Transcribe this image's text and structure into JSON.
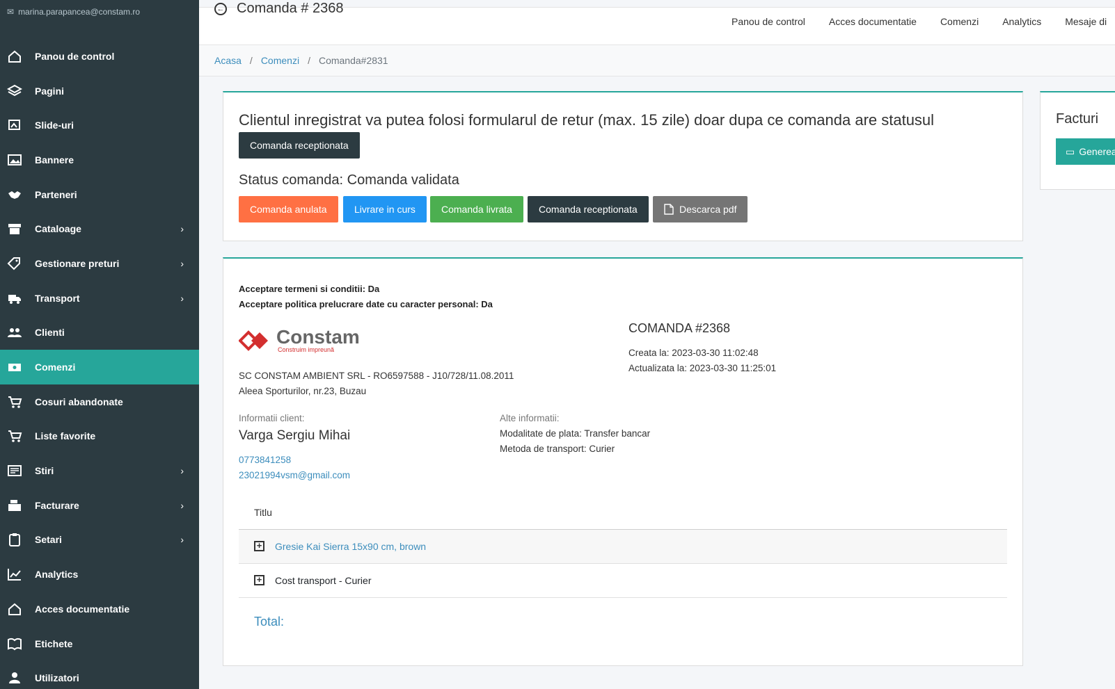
{
  "user": {
    "email": "marina.parapancea@constam.ro"
  },
  "sidebar": {
    "items": [
      {
        "label": "Panou de control",
        "icon": "home-icon",
        "has_children": false,
        "active": false
      },
      {
        "label": "Pagini",
        "icon": "layers-icon",
        "has_children": false,
        "active": false
      },
      {
        "label": "Slide-uri",
        "icon": "slides-icon",
        "has_children": false,
        "active": false
      },
      {
        "label": "Bannere",
        "icon": "image-icon",
        "has_children": false,
        "active": false
      },
      {
        "label": "Parteneri",
        "icon": "handshake-icon",
        "has_children": false,
        "active": false
      },
      {
        "label": "Cataloage",
        "icon": "archive-icon",
        "has_children": true,
        "active": false
      },
      {
        "label": "Gestionare preturi",
        "icon": "tags-icon",
        "has_children": true,
        "active": false
      },
      {
        "label": "Transport",
        "icon": "truck-icon",
        "has_children": true,
        "active": false
      },
      {
        "label": "Clienti",
        "icon": "users-icon",
        "has_children": false,
        "active": false
      },
      {
        "label": "Comenzi",
        "icon": "money-icon",
        "has_children": false,
        "active": true
      },
      {
        "label": "Cosuri abandonate",
        "icon": "cart-icon",
        "has_children": false,
        "active": false
      },
      {
        "label": "Liste favorite",
        "icon": "cart-plus-icon",
        "has_children": false,
        "active": false
      },
      {
        "label": "Stiri",
        "icon": "newspaper-icon",
        "has_children": true,
        "active": false
      },
      {
        "label": "Facturare",
        "icon": "cash-register-icon",
        "has_children": true,
        "active": false
      },
      {
        "label": "Setari",
        "icon": "clipboard-icon",
        "has_children": true,
        "active": false
      },
      {
        "label": "Analytics",
        "icon": "chart-icon",
        "has_children": false,
        "active": false
      },
      {
        "label": "Acces documentatie",
        "icon": "home-icon",
        "has_children": false,
        "active": false
      },
      {
        "label": "Etichete",
        "icon": "book-icon",
        "has_children": false,
        "active": false
      },
      {
        "label": "Utilizatori",
        "icon": "user-icon",
        "has_children": false,
        "active": false
      }
    ]
  },
  "header": {
    "title": "Comanda # 2368",
    "nav": [
      "Panou de control",
      "Acces documentatie",
      "Comenzi",
      "Analytics",
      "Mesaje di"
    ]
  },
  "breadcrumb": {
    "home": "Acasa",
    "sep": "/",
    "section": "Comenzi",
    "current": "Comanda#2831"
  },
  "status_card": {
    "notice": "Clientul inregistrat va putea folosi formularul de retur (max. 15 zile) doar dupa ce comanda are statusul",
    "notice_badge": "Comanda receptionata",
    "status_text": "Status comanda: Comanda validata",
    "buttons": {
      "cancelled": "Comanda anulata",
      "in_delivery": "Livrare in curs",
      "delivered": "Comanda livrata",
      "received": "Comanda receptionata",
      "download_pdf": "Descarca pdf"
    },
    "colors": {
      "orange": "#ff7043",
      "blue": "#2196f3",
      "green": "#4caf50",
      "dark": "#2c3b41",
      "grey": "#757575"
    }
  },
  "order": {
    "terms": "Acceptare termeni si conditii: Da",
    "privacy": "Acceptare politica prelucrare date cu caracter personal: Da",
    "logo_name": "Constam",
    "logo_slogan": "Construim impreună",
    "company_line": "SC CONSTAM AMBIENT SRL - RO6597588 - J10/728/11.08.2011",
    "address": "Aleea Sporturilor, nr.23, Buzau",
    "order_title": "COMANDA #2368",
    "created": "Creata la: 2023-03-30 11:02:48",
    "updated": "Actualizata la: 2023-03-30 11:25:01",
    "client_label": "Informatii client:",
    "client_name": "Varga Sergiu Mihai",
    "phone": "0773841258",
    "email": "23021994vsm@gmail.com",
    "other_label": "Alte informatii:",
    "payment": "Modalitate de plata: Transfer bancar",
    "shipping": "Metoda de transport: Curier",
    "table_header": "Titlu",
    "rows": [
      {
        "label": "Gresie Kai Sierra 15x90 cm, brown",
        "link": true
      },
      {
        "label": "Cost transport - Curier",
        "link": false
      }
    ],
    "total_label": "Total:"
  },
  "invoices": {
    "title": "Facturi",
    "button": "Genereaz"
  }
}
